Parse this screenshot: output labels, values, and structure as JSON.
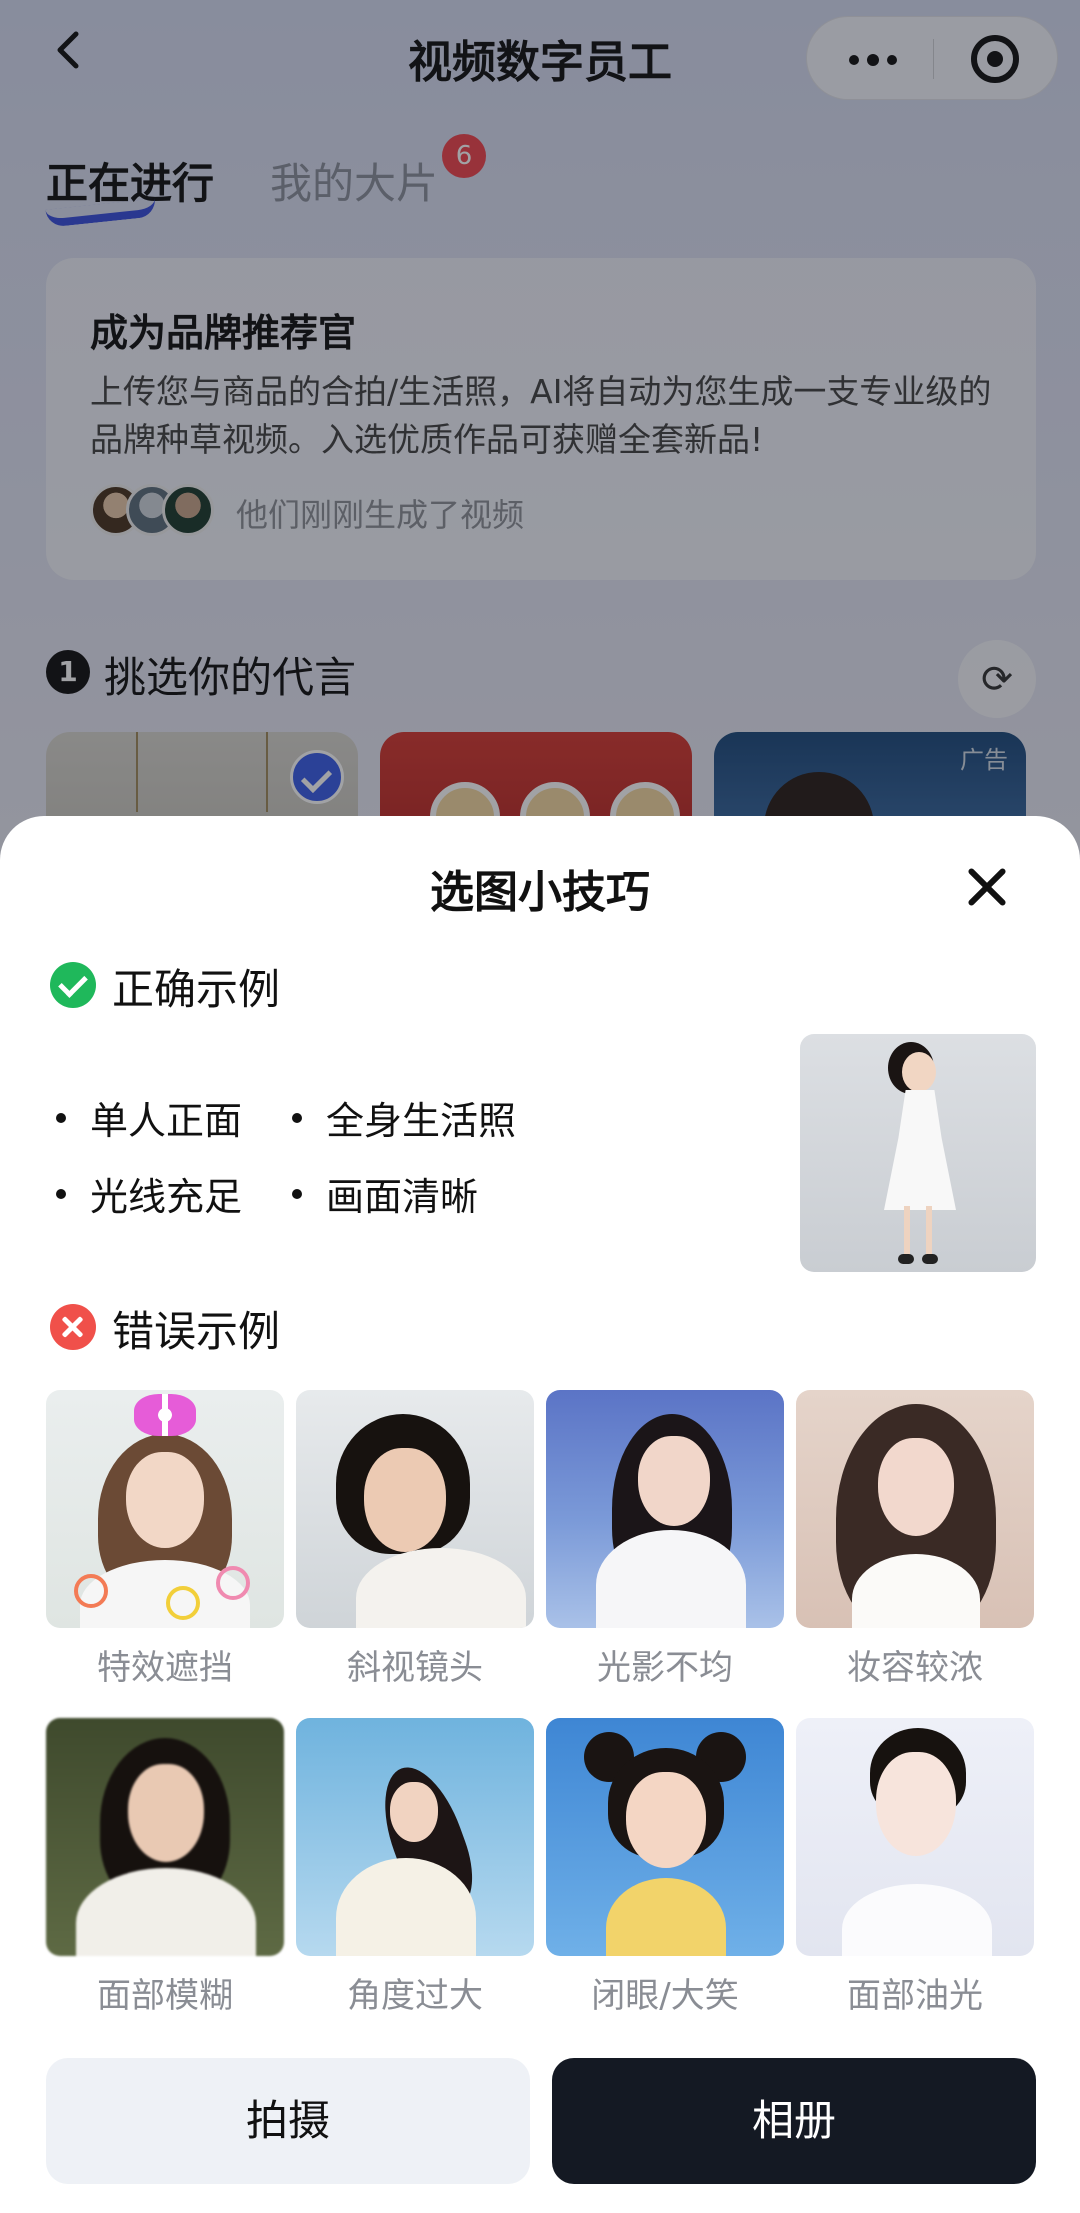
{
  "nav": {
    "title": "视频数字员工"
  },
  "tabs": [
    {
      "label": "正在进行",
      "active": true
    },
    {
      "label": "我的大片",
      "badge": "6"
    }
  ],
  "promo": {
    "title": "成为品牌推荐官",
    "description": "上传您与商品的合拍/生活照，AI将自动为您生成一支专业级的品牌种草视频。入选优质作品可获赠全套新品!",
    "social_proof": "他们刚刚生成了视频"
  },
  "step1": {
    "number": "1",
    "label": "挑选你的代言",
    "refresh_icon": "refresh-icon",
    "thumbnails": [
      {
        "selected": true
      },
      {
        "selected": false
      },
      {
        "tag": "广告"
      }
    ]
  },
  "sheet": {
    "title": "选图小技巧",
    "correct": {
      "label": "正确示例",
      "tips": [
        "单人正面",
        "全身生活照",
        "光线充足",
        "画面清晰"
      ]
    },
    "wrong": {
      "label": "错误示例",
      "examples": [
        "特效遮挡",
        "斜视镜头",
        "光影不均",
        "妆容较浓",
        "面部模糊",
        "角度过大",
        "闭眼/大笑",
        "面部油光"
      ]
    }
  },
  "actions": {
    "shoot": "拍摄",
    "album": "相册"
  },
  "colors": {
    "accent": "#3b5ee8",
    "ok": "#1fb85b",
    "error": "#f0504a",
    "primary_button": "#141923"
  }
}
